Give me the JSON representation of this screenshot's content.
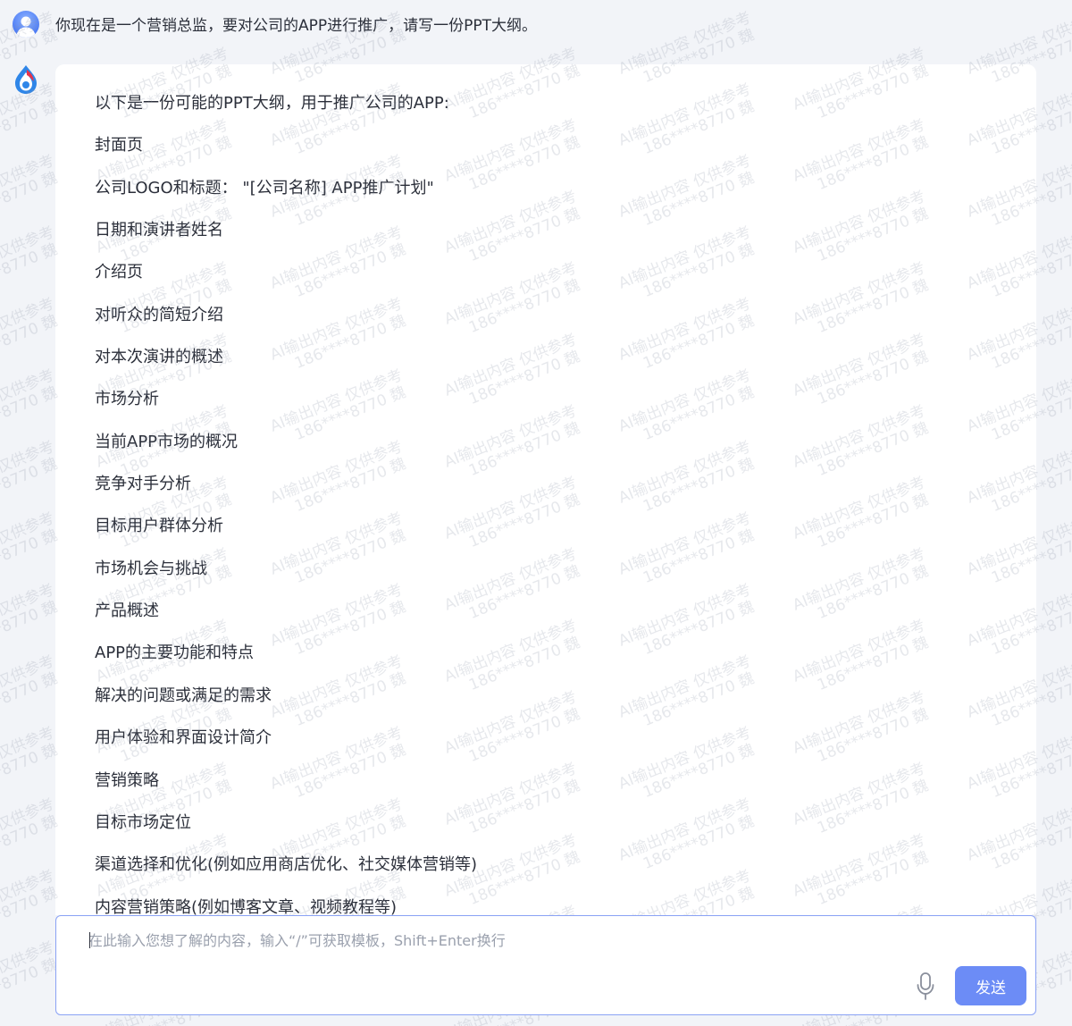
{
  "conversation": {
    "user_message": "你现在是一个营销总监，要对公司的APP进行推广，请写一份PPT大纲。",
    "assistant_lines": [
      "以下是一份可能的PPT大纲，用于推广公司的APP:",
      "封面页",
      "公司LOGO和标题：  \"[公司名称] APP推广计划\"",
      "日期和演讲者姓名",
      "介绍页",
      "对听众的简短介绍",
      "对本次演讲的概述",
      "市场分析",
      "当前APP市场的概况",
      "竞争对手分析",
      "目标用户群体分析",
      "市场机会与挑战",
      "产品概述",
      "APP的主要功能和特点",
      "解决的问题或满足的需求",
      "用户体验和界面设计简介",
      "营销策略",
      "目标市场定位",
      "渠道选择和优化(例如应用商店优化、社交媒体营销等)",
      "内容营销策略(例如博客文章、视频教程等)"
    ]
  },
  "watermark": {
    "line1": "AI输出内容 仅供参考",
    "line2": "186****8770 魏"
  },
  "composer": {
    "placeholder": "在此输入您想了解的内容，输入“/”可获取模板，Shift+Enter换行",
    "send_label": "发送"
  },
  "icons": {
    "user_avatar": "user-avatar-icon",
    "assistant_avatar": "flame-drop-logo-icon",
    "microphone": "microphone-icon"
  },
  "colors": {
    "accent": "#6c8cf6",
    "input_border": "#8aa2f5",
    "background": "#f2f4f8"
  }
}
